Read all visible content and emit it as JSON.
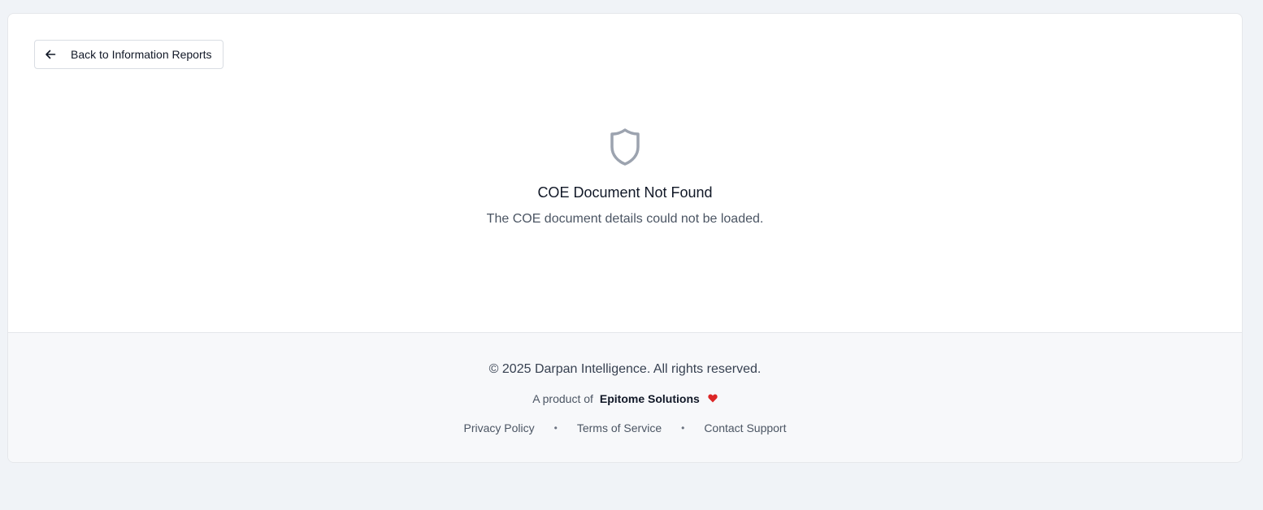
{
  "back_button": {
    "label": "Back to Information Reports",
    "icon": "arrow-left-icon"
  },
  "empty_state": {
    "icon": "shield-icon",
    "title": "COE Document Not Found",
    "description": "The COE document details could not be loaded."
  },
  "footer": {
    "copyright": "© 2025 Darpan Intelligence. All rights reserved.",
    "product_prefix": "A product of",
    "product_name": "Epitome Solutions",
    "heart_icon": "heart-icon",
    "links": {
      "privacy": "Privacy Policy",
      "terms": "Terms of Service",
      "contact": "Contact Support"
    },
    "separator": "•"
  },
  "colors": {
    "page_background": "#f0f3f7",
    "card_background": "#ffffff",
    "footer_background": "#f7f8fa",
    "heart": "#dc2626",
    "shield": "#9ca3af"
  }
}
